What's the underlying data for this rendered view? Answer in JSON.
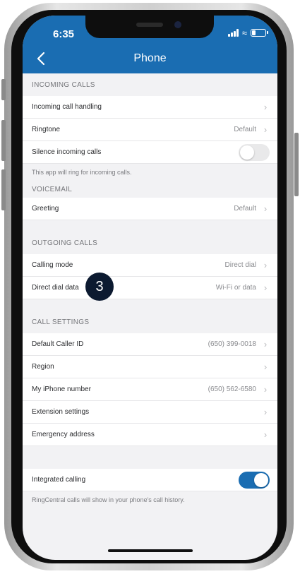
{
  "status_bar": {
    "time": "6:35"
  },
  "header": {
    "title": "Phone"
  },
  "sections": {
    "incoming": {
      "title": "INCOMING CALLS",
      "call_handling": {
        "label": "Incoming call handling",
        "value": ""
      },
      "ringtone": {
        "label": "Ringtone",
        "value": "Default"
      },
      "silence": {
        "label": "Silence incoming calls",
        "toggle": "off"
      },
      "footnote": "This app will ring for incoming calls."
    },
    "voicemail": {
      "title": "VOICEMAIL",
      "greeting": {
        "label": "Greeting",
        "value": "Default"
      }
    },
    "outgoing": {
      "title": "OUTGOING CALLS",
      "calling_mode": {
        "label": "Calling mode",
        "value": "Direct dial"
      },
      "direct_dial_data": {
        "label": "Direct dial data",
        "value": "Wi-Fi or data"
      }
    },
    "call_settings": {
      "title": "CALL SETTINGS",
      "caller_id": {
        "label": "Default Caller ID",
        "value": "(650) 399-0018"
      },
      "region": {
        "label": "Region",
        "value": ""
      },
      "iphone_number": {
        "label": "My iPhone number",
        "value": "(650) 562-6580"
      },
      "extension": {
        "label": "Extension settings",
        "value": ""
      },
      "emergency": {
        "label": "Emergency address",
        "value": ""
      }
    },
    "integrated": {
      "label": "Integrated calling",
      "toggle": "on",
      "footnote": "RingCentral calls will show in your phone's call history."
    }
  },
  "step_badge": "3",
  "icons": {
    "back": "chevron-left-icon",
    "row_arrow": "chevron-right-icon",
    "signal": "signal-icon",
    "wifi": "wifi-icon",
    "battery": "battery-icon"
  },
  "colors": {
    "header": "#1a6db2",
    "toggle_on": "#1a6db2",
    "badge": "#0c1a30",
    "background": "#f2f2f4"
  }
}
